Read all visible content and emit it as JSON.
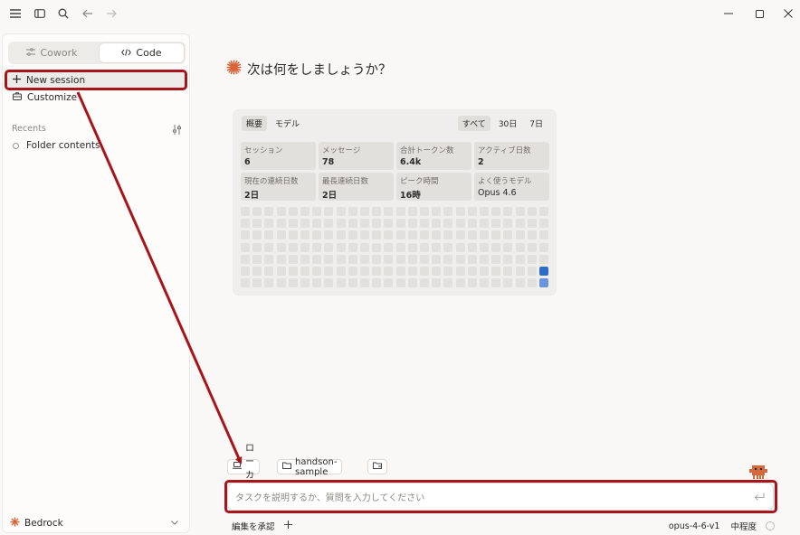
{
  "titlebar": {
    "menu_icon": "hamburger-icon",
    "sidebar_icon": "sidebar-toggle-icon",
    "search_icon": "search-icon",
    "back_icon": "arrow-left-icon",
    "forward_icon": "arrow-right-icon",
    "window_controls": [
      "minimize-icon",
      "maximize-icon",
      "close-icon"
    ]
  },
  "sidebar": {
    "modes": [
      {
        "label": "Cowork",
        "icon": "cowork-icon",
        "active": false
      },
      {
        "label": "Code",
        "icon": "code-icon",
        "active": true
      }
    ],
    "new_session": "New session",
    "customize": "Customize",
    "recents_label": "Recents",
    "recents": [
      "Folder contents"
    ],
    "account": "Bedrock"
  },
  "main": {
    "heading": "次は何をしましょうか？",
    "stats": {
      "tabs_left": [
        {
          "label": "概要",
          "active": true
        },
        {
          "label": "モデル",
          "active": false
        }
      ],
      "tabs_right": [
        {
          "label": "すべて",
          "active": true
        },
        {
          "label": "30日",
          "active": false
        },
        {
          "label": "7日",
          "active": false
        }
      ],
      "cells": [
        {
          "label": "セッション",
          "value": "6"
        },
        {
          "label": "メッセージ",
          "value": "78"
        },
        {
          "label": "合計トークン数",
          "value": "6.4k"
        },
        {
          "label": "アクティブ日数",
          "value": "2"
        },
        {
          "label": "現在の連続日数",
          "value": "2日"
        },
        {
          "label": "最長連続日数",
          "value": "2日"
        },
        {
          "label": "ピーク時間",
          "value": "16時"
        },
        {
          "label": "よく使うモデル",
          "value": "Opus 4.6"
        }
      ],
      "heatmap": {
        "columns": 26,
        "rows": 7,
        "active_cells": [
          [
            25,
            5,
            "#2f6cc9"
          ],
          [
            25,
            6,
            "#6a95dc"
          ]
        ]
      }
    },
    "chips": {
      "local": "ローカル",
      "folder": "handson-sample"
    },
    "input_placeholder": "タスクを説明するか、質問を入力してください",
    "bottom": {
      "approve": "編集を承認",
      "model": "opus-4-6-v1",
      "effort": "中程度"
    }
  },
  "colors": {
    "highlight": "#a8141b",
    "accent": "#d9643a",
    "heat_active": "#2f6cc9"
  }
}
